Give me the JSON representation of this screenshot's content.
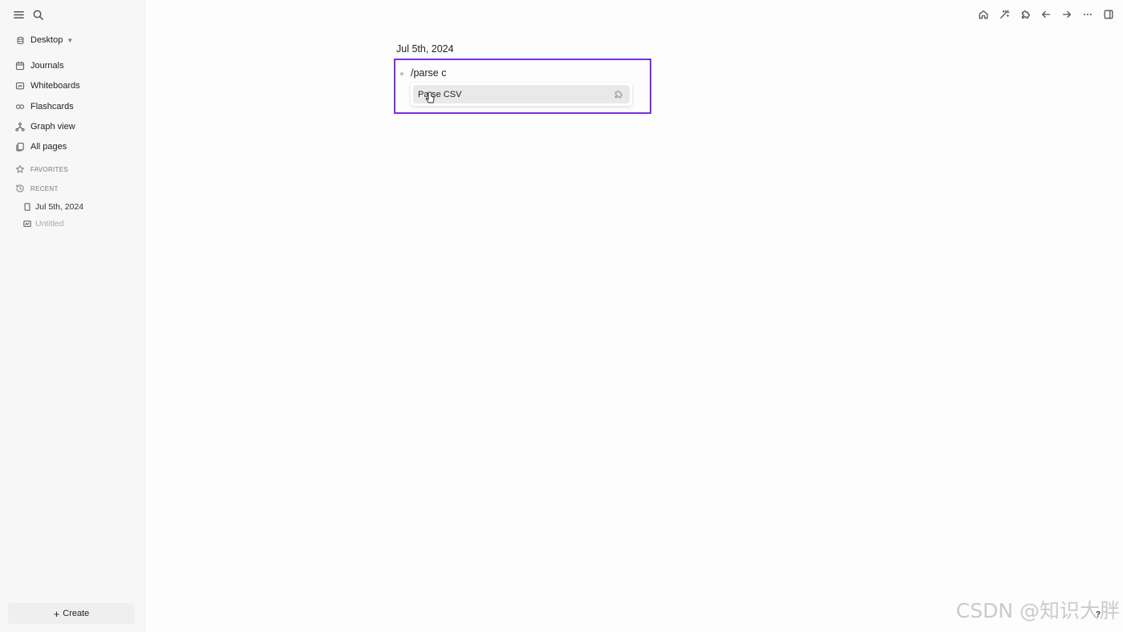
{
  "sidebar": {
    "graph_name": "Desktop",
    "nav": [
      {
        "label": "Journals",
        "icon": "calendar-icon"
      },
      {
        "label": "Whiteboards",
        "icon": "whiteboard-icon"
      },
      {
        "label": "Flashcards",
        "icon": "infinity-icon"
      },
      {
        "label": "Graph view",
        "icon": "hierarchy-icon"
      },
      {
        "label": "All pages",
        "icon": "files-icon"
      }
    ],
    "favorites_label": "FAVORITES",
    "recent_label": "RECENT",
    "recent": [
      {
        "label": "Jul 5th, 2024",
        "icon": "page-icon"
      },
      {
        "label": "Untitled",
        "icon": "whiteboard-icon"
      }
    ],
    "create_label": "Create"
  },
  "main": {
    "journal_title": "Jul 5th, 2024",
    "block_text": "/parse c",
    "autocomplete": {
      "item_label": "Parse CSV",
      "item_icon": "puzzle-icon"
    }
  },
  "toolbar": [
    "home-icon",
    "magic-wand-icon",
    "puzzle-icon",
    "arrow-left-icon",
    "arrow-right-icon",
    "more-icon",
    "sidebar-toggle-icon"
  ],
  "help_label": "?",
  "watermark": "CSDN @知识大胖",
  "colors": {
    "highlight": "#7b2ee0"
  }
}
